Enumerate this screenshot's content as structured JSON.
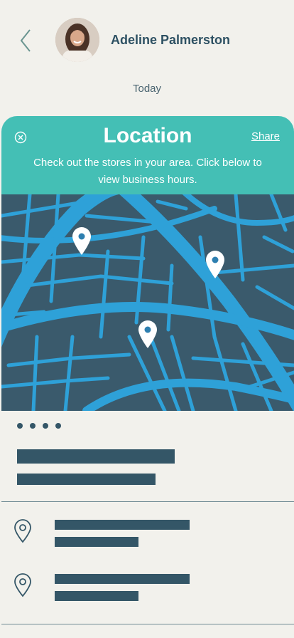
{
  "header": {
    "back_icon": "chevron-left-icon",
    "contact_name": "Adeline Palmerston",
    "date_label": "Today"
  },
  "card": {
    "close_icon": "close-circle-icon",
    "title": "Location",
    "share_label": "Share",
    "description": "Check out the stores in your area. Click below to view business hours.",
    "map_pin_icon": "map-pin-icon",
    "list_location_icon": "location-outline-icon"
  },
  "colors": {
    "background": "#f2f1ec",
    "header_teal": "#44bfb5",
    "map_dark": "#3a5a6c",
    "map_roads": "#2ea1d8",
    "placeholder_bars": "#345667"
  }
}
